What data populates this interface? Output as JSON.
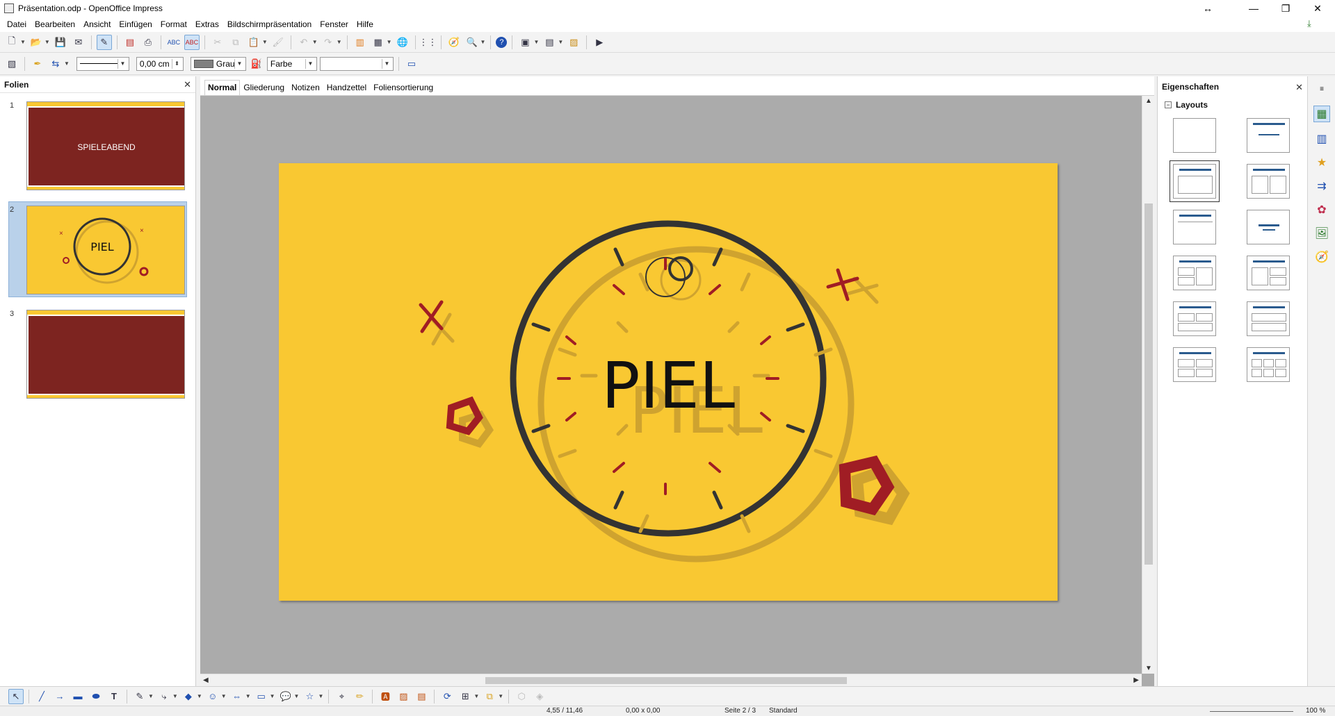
{
  "window": {
    "title": "Präsentation.odp - OpenOffice Impress",
    "controls": {
      "restore_glyph": "↔",
      "minimize": "—",
      "maximize": "❐",
      "close": "✕"
    }
  },
  "menu": {
    "items": [
      {
        "label": "Datei"
      },
      {
        "label": "Bearbeiten"
      },
      {
        "label": "Ansicht"
      },
      {
        "label": "Einfügen"
      },
      {
        "label": "Format"
      },
      {
        "label": "Extras"
      },
      {
        "label": "Bildschirmpräsentation"
      },
      {
        "label": "Fenster"
      },
      {
        "label": "Hilfe"
      }
    ]
  },
  "toolbar2": {
    "line_width": "0,00 cm",
    "line_color": "Grau",
    "line_color_hex": "#808080",
    "area_style": "Farbe",
    "area_fill": ""
  },
  "slides_panel": {
    "title": "Folien",
    "close": "✕",
    "slides": [
      {
        "number": "1",
        "text": "SPIELEABEND"
      },
      {
        "number": "2",
        "text": "PIEL"
      },
      {
        "number": "3",
        "text": ""
      }
    ],
    "selected_index": 2
  },
  "editor": {
    "tabs": [
      {
        "label": "Normal",
        "active": true
      },
      {
        "label": "Gliederung"
      },
      {
        "label": "Notizen"
      },
      {
        "label": "Handzettel"
      },
      {
        "label": "Foliensortierung"
      }
    ],
    "slide": {
      "title_text": "PIEL",
      "shadow_text": "PIEL",
      "background": "#f9c832",
      "accent_dark": "#333333",
      "accent_red": "#a01d24",
      "accent_shadow": "#cfa32f"
    }
  },
  "properties": {
    "title": "Eigenschaften",
    "close": "✕",
    "section": "Layouts",
    "selected_layout_index": 2
  },
  "theme": {
    "slide1_bg": "#7d2420",
    "slide_border": "#f9c832"
  },
  "status": {
    "position": "4,55 / 11,46",
    "size": "0,00 x 0,00",
    "page": "Seite 2 / 3",
    "master": "Standard",
    "zoom": "100 %"
  }
}
